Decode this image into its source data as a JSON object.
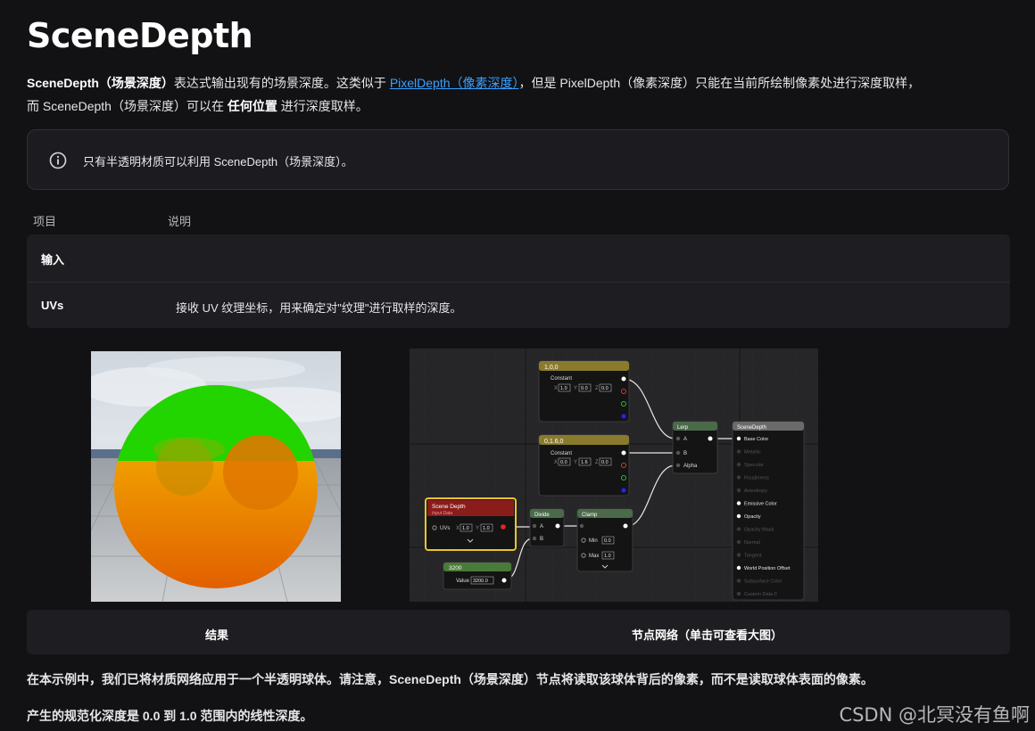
{
  "page": {
    "title": "SceneDepth",
    "intro": {
      "bold_term": "SceneDepth（场景深度）",
      "text1": "表达式输出现有的场景深度。这类似于 ",
      "link": "PixelDepth（像素深度）",
      "text2": "，但是 PixelDepth（像素深度）只能在当前所绘制像素处进行深度取样，",
      "text3": "而 SceneDepth（场景深度）可以在 ",
      "bold2": "任何位置",
      "text4": " 进行深度取样。"
    },
    "note": {
      "icon": "info-icon",
      "text": "只有半透明材质可以利用 SceneDepth（场景深度）。"
    },
    "table": {
      "headers": [
        "项目",
        "说明"
      ],
      "rows": [
        {
          "item": "输入",
          "desc": ""
        },
        {
          "item": "UVs",
          "desc": "接收 UV 纹理坐标，用来确定对\"纹理\"进行取样的深度。"
        }
      ]
    },
    "graph": {
      "nodes": {
        "const1": {
          "title": "1,0,0",
          "label": "Constant",
          "x": "1.0",
          "y": "0.0",
          "z": "0.0"
        },
        "const2": {
          "title": "0,1.6,0",
          "label": "Constant",
          "x": "0.0",
          "y": "1.6",
          "z": "0.0"
        },
        "scene_depth": {
          "title": "Scene Depth",
          "subtitle": "Input Data",
          "input": "UVs",
          "x": "1.0",
          "y": "1.0"
        },
        "divide": {
          "title": "Divide",
          "a": "A",
          "b": "B"
        },
        "clamp": {
          "title": "Clamp",
          "min_label": "Min",
          "min": "0.0",
          "max_label": "Max",
          "max": "1.0"
        },
        "value": {
          "title": "3200",
          "label": "Value",
          "value": "3200.0"
        },
        "lerp": {
          "title": "Lerp",
          "a": "A",
          "b": "B",
          "alpha": "Alpha"
        },
        "material": {
          "title": "SceneDepth",
          "pins": [
            "Base Color",
            "Metallic",
            "Specular",
            "Roughness",
            "Anisotropy",
            "Emissive Color",
            "Opacity",
            "Opacity Mask",
            "Normal",
            "Tangent",
            "World Position Offset",
            "Subsurface Color",
            "Custom Data 0"
          ],
          "active": [
            true,
            false,
            false,
            false,
            false,
            true,
            true,
            false,
            false,
            false,
            true,
            false,
            false
          ]
        }
      }
    },
    "captions": {
      "result": "结果",
      "graph": "节点网络（单击可查看大图）"
    },
    "paragraphs": [
      "在本示例中，我们已将材质网络应用于一个半透明球体。请注意，SceneDepth（场景深度）节点将读取该球体背后的像素，而不是读取球体表面的像素。",
      "产生的规范化深度是 0.0 到 1.0 范围内的线性深度。"
    ],
    "watermark": "CSDN @北冥没有鱼啊",
    "colors": {
      "link": "#3aa0ff",
      "background": "#121215",
      "panel": "#1e1e22"
    }
  }
}
